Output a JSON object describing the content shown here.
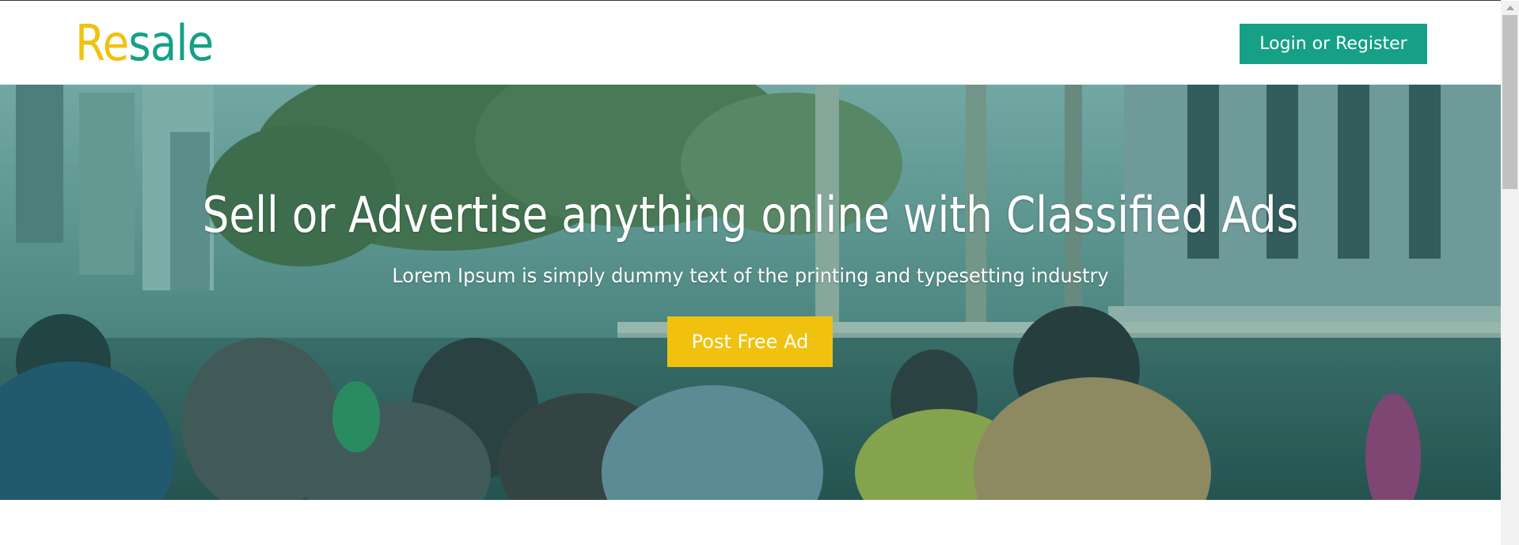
{
  "header": {
    "logo": {
      "part1": "Re",
      "part2": "sale"
    },
    "login_button_label": "Login or Register"
  },
  "hero": {
    "title": "Sell or Advertise anything online with Classified Ads",
    "subtitle": "Lorem Ipsum is simply dummy text of the printing and typesetting industry",
    "cta_label": "Post Free Ad",
    "background_image": "crowd-street-photo"
  },
  "colors": {
    "brand_yellow": "#f0c20f",
    "brand_green": "#16a086"
  }
}
